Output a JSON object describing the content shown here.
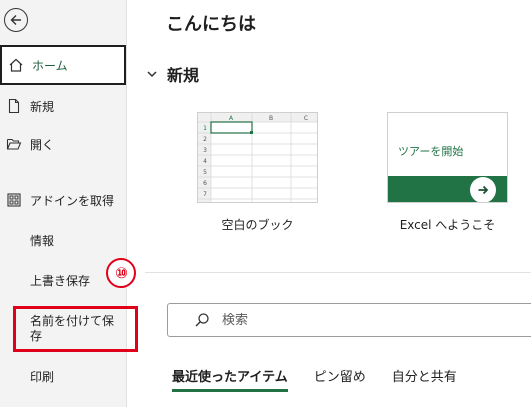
{
  "sidebar": {
    "items": [
      {
        "id": "home",
        "label": "ホーム",
        "icon": "home-icon"
      },
      {
        "id": "new",
        "label": "新規",
        "icon": "new-document-icon"
      },
      {
        "id": "open",
        "label": "開く",
        "icon": "folder-open-icon"
      },
      {
        "id": "addins",
        "label": "アドインを取得",
        "icon": "grid-icon"
      },
      {
        "id": "info",
        "label": "情報"
      },
      {
        "id": "save",
        "label": "上書き保存"
      },
      {
        "id": "save_as",
        "label": "名前を付けて保存"
      },
      {
        "id": "print",
        "label": "印刷"
      }
    ],
    "active": "home"
  },
  "annotation": {
    "step_number": "⑩",
    "highlight_color": "#e0001a"
  },
  "main": {
    "greeting": "こんにちは",
    "new_section_label": "新規",
    "templates": [
      {
        "caption": "空白のブック"
      },
      {
        "caption": "Excel へようこそ",
        "tour_text": "ツアーを開始"
      }
    ],
    "sheet_preview": {
      "columns": [
        "A",
        "B",
        "C"
      ],
      "rows": [
        "1",
        "2",
        "3",
        "4",
        "5",
        "6",
        "7"
      ]
    },
    "search": {
      "placeholder": "検索"
    },
    "tabs": [
      {
        "label": "最近使ったアイテム",
        "active": true
      },
      {
        "label": "ピン留め",
        "active": false
      },
      {
        "label": "自分と共有",
        "active": false
      }
    ]
  },
  "colors": {
    "accent": "#217346",
    "sidebar_bg": "#f3f3f3"
  }
}
